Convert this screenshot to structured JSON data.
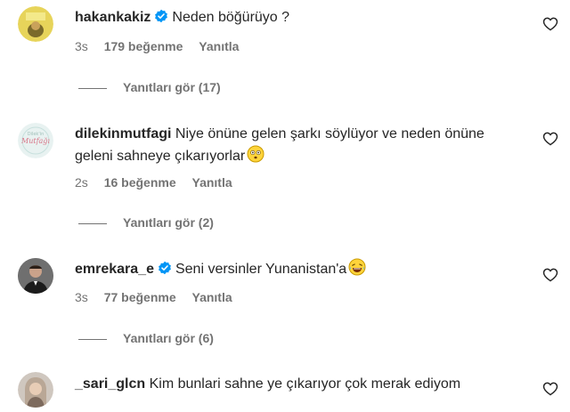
{
  "comments": [
    {
      "username": "hakankakiz",
      "verified": true,
      "text": "Neden böğürüyo ?",
      "time": "3s",
      "likes": "179 beğenme",
      "reply": "Yanıtla",
      "view_replies": "Yanıtları gör (17)"
    },
    {
      "username": "dilekinmutfagi",
      "verified": false,
      "text": "Niye önüne gelen şarkı söylüyor ve neden önüne geleni sahneye çıkarıyorlar",
      "emoji": "flushed-face-emoji",
      "time": "2s",
      "likes": "16 beğenme",
      "reply": "Yanıtla",
      "view_replies": "Yanıtları gör (2)"
    },
    {
      "username": "emrekara_e",
      "verified": true,
      "text": "Seni versinler Yunanistan'a",
      "emoji": "laughing-tears-emoji",
      "time": "3s",
      "likes": "77 beğenme",
      "reply": "Yanıtla",
      "view_replies": "Yanıtları gör (6)"
    },
    {
      "username": "_sari_glcn",
      "verified": false,
      "text": "Kim bunlari sahne ye çıkarıyor çok merak ediyom"
    }
  ],
  "colors": {
    "text": "#262626",
    "secondary": "#737373",
    "verified": "#0095f6",
    "background": "#ffffff"
  }
}
